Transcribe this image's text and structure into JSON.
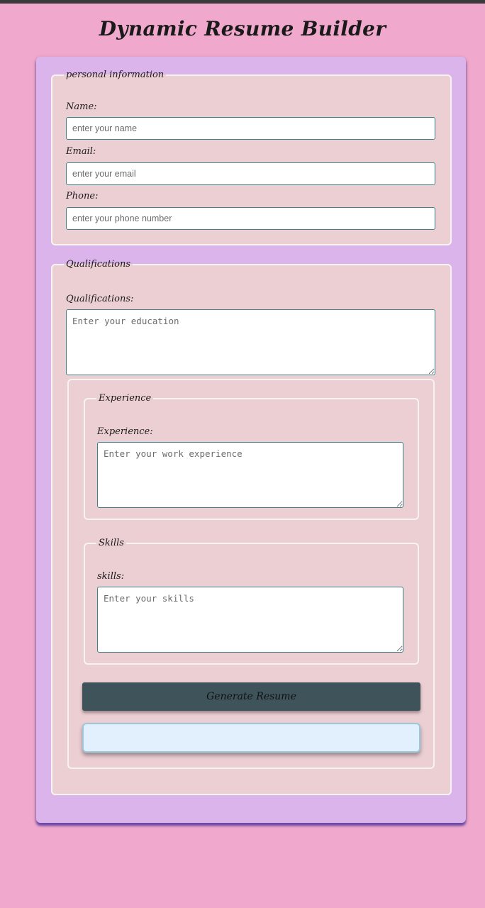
{
  "header": {
    "title": "Dynamic Resume Builder"
  },
  "personal": {
    "legend": "personal information",
    "name_label": "Name:",
    "name_placeholder": "enter your name",
    "email_label": "Email:",
    "email_placeholder": "enter your email",
    "phone_label": "Phone:",
    "phone_placeholder": "enter your phone number"
  },
  "qualifications": {
    "legend": "Qualifications",
    "label": "Qualifications:",
    "placeholder": "Enter your education"
  },
  "experience": {
    "legend": "Experience",
    "label": "Experience:",
    "placeholder": "Enter your work experience"
  },
  "skills": {
    "legend": "Skills",
    "label": "skills:",
    "placeholder": "Enter your skills"
  },
  "actions": {
    "generate_label": "Generate Resume"
  }
}
